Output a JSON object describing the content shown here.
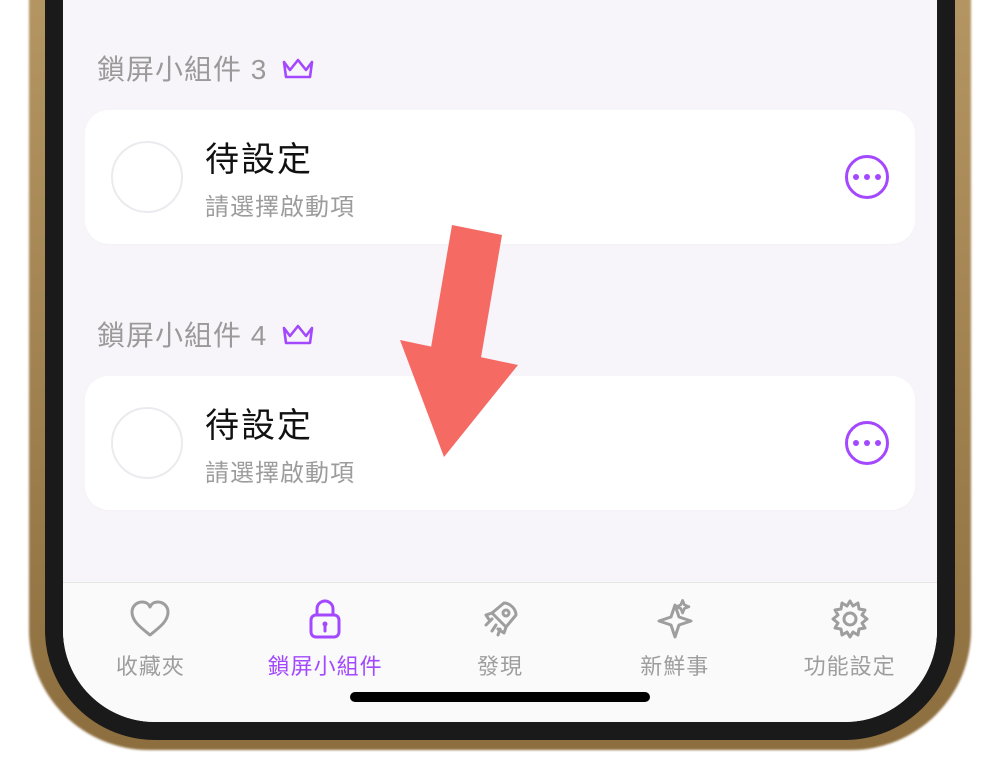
{
  "colors": {
    "accent": "#a348ff",
    "text_muted": "#9a9a9a",
    "page_bg": "#f7f5f9",
    "card_bg": "#ffffff",
    "arrow": "#f66a64"
  },
  "sections": [
    {
      "header": "鎖屏小組件 3",
      "card": {
        "title": "待設定",
        "subtitle": "請選擇啟動項"
      }
    },
    {
      "header": "鎖屏小組件 4",
      "card": {
        "title": "待設定",
        "subtitle": "請選擇啟動項"
      }
    }
  ],
  "tabbar": {
    "items": [
      {
        "icon": "heart",
        "label": "收藏夾",
        "active": false
      },
      {
        "icon": "lock",
        "label": "鎖屏小組件",
        "active": true
      },
      {
        "icon": "rocket",
        "label": "發現",
        "active": false
      },
      {
        "icon": "sparkle",
        "label": "新鮮事",
        "active": false
      },
      {
        "icon": "gear",
        "label": "功能設定",
        "active": false
      }
    ]
  },
  "annotation": {
    "arrow_points_to": "sections.1.card"
  }
}
